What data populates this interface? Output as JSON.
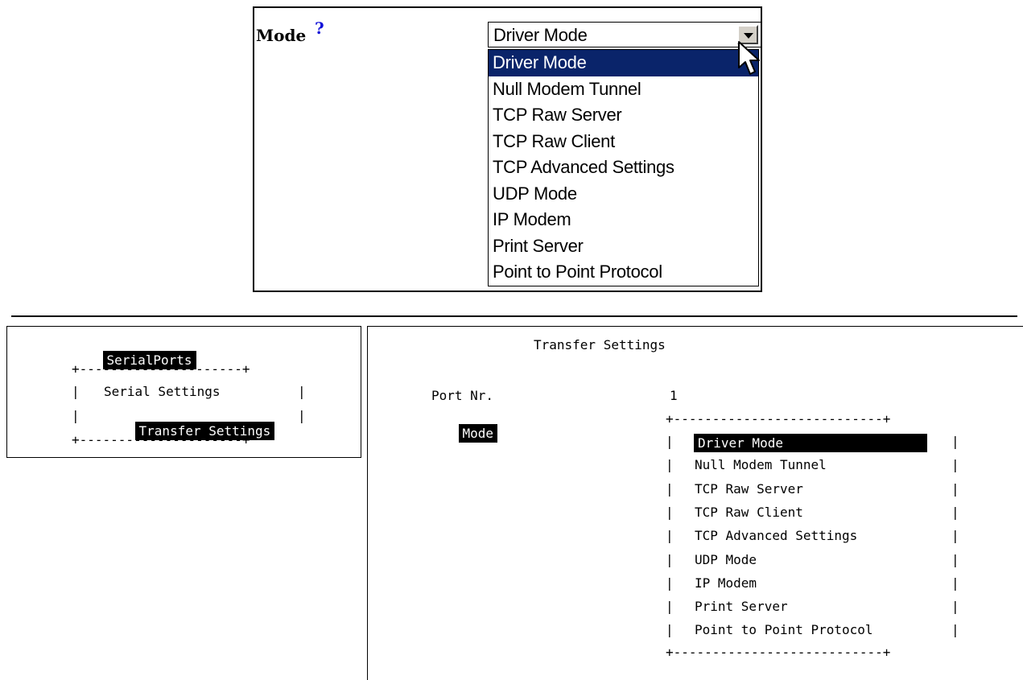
{
  "web": {
    "mode_label": "Mode",
    "help_glyph": "?",
    "help_icon": "question-mark-icon",
    "help_color": "#1010d8",
    "select_value": "Driver Mode",
    "selected_color": "#0a246a",
    "options": [
      "Driver Mode",
      "Null Modem Tunnel",
      "TCP Raw Server",
      "TCP Raw Client",
      "TCP Advanced Settings",
      "UDP Mode",
      "IP Modem",
      "Print Server",
      "Point to Point Protocol"
    ]
  },
  "terminal": {
    "menu_title": "SerialPorts",
    "menu_border": "+---------------------+",
    "menu_items": [
      "Serial Settings",
      "Transfer Settings"
    ],
    "pipe": "|",
    "page_title": "Transfer Settings",
    "port_label": "Port Nr.",
    "port_value": "1",
    "mode_label": "Mode",
    "list_border": "+---------------------------+",
    "list_options": [
      "Driver Mode",
      "Null Modem Tunnel",
      "TCP Raw Server",
      "TCP Raw Client",
      "TCP Advanced Settings",
      "UDP Mode",
      "IP Modem",
      "Print Server",
      "Point to Point Protocol"
    ]
  }
}
